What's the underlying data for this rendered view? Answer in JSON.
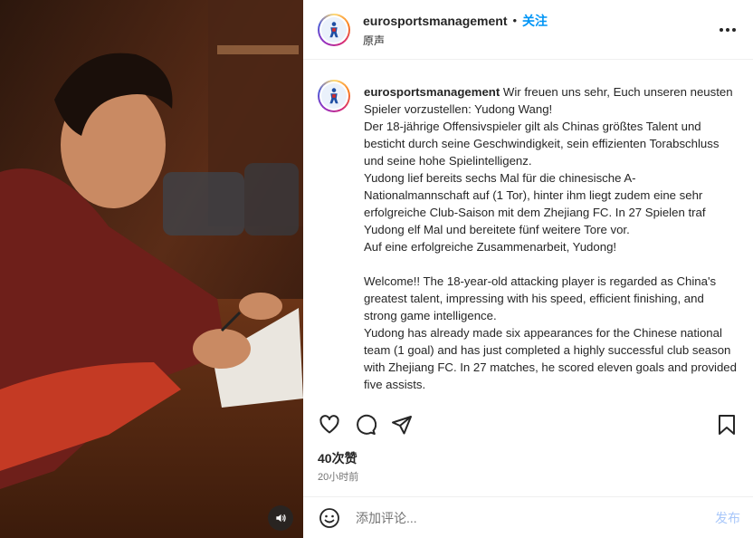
{
  "header": {
    "username": "eurosportsmanagement",
    "separator": "•",
    "follow_label": "关注",
    "subline": "原声"
  },
  "caption": {
    "username": "eurosportsmanagement",
    "lines": [
      "Wir freuen uns sehr, Euch unseren neusten Spieler vorzustellen: Yudong Wang!",
      "Der 18-jährige Offensivspieler gilt als Chinas größtes Talent und besticht durch seine Geschwindigkeit, sein effizienten Torabschluss und seine hohe Spielintelligenz.",
      "Yudong lief bereits sechs Mal für die chinesische A-Nationalmannschaft auf (1 Tor), hinter ihm liegt zudem eine sehr erfolgreiche Club-Saison mit dem Zhejiang FC. In 27 Spielen traf Yudong elf Mal und bereitete fünf weitere Tore vor.",
      "Auf eine erfolgreiche Zusammenarbeit, Yudong!",
      "",
      "Welcome!! The 18-year-old attacking player is regarded as China's greatest talent, impressing with his speed, efficient finishing, and strong game intelligence.",
      "Yudong has already made six appearances for the Chinese national team (1 goal) and has just completed a highly successful club season with Zhejiang FC. In 27 matches, he scored eleven goals and provided five assists."
    ]
  },
  "stats": {
    "likes": "40次赞",
    "time": "20小时前"
  },
  "comment": {
    "placeholder": "添加评论...",
    "post_label": "发布"
  },
  "icons": {
    "like": "heart-icon",
    "comment": "comment-icon",
    "share": "send-icon",
    "save": "bookmark-icon",
    "emoji": "emoji-icon",
    "more": "more-icon",
    "audio": "speaker-icon"
  },
  "colors": {
    "follow": "#0095f6",
    "post_disabled": "#a8c7fa",
    "muted_text": "#737373"
  }
}
